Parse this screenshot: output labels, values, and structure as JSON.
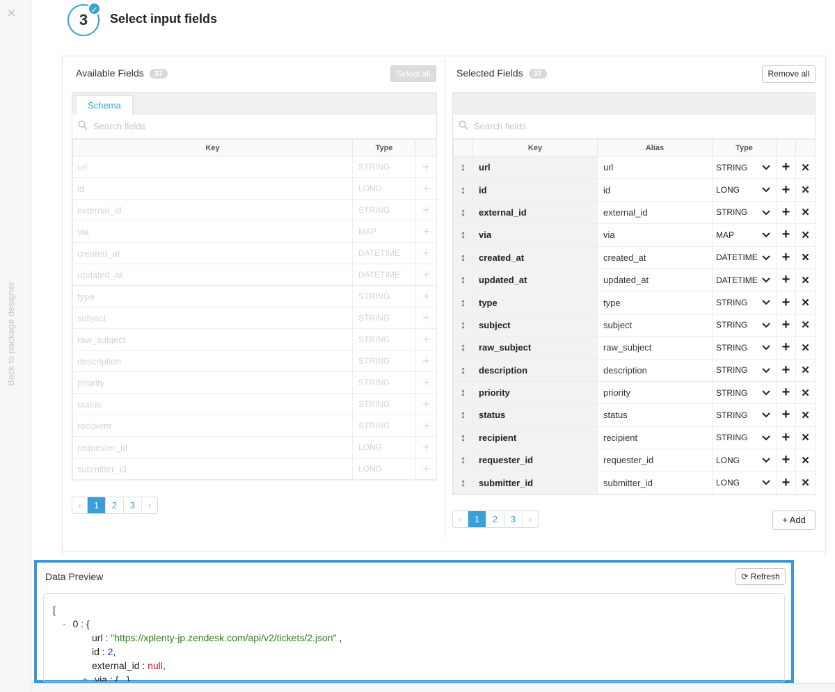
{
  "sidebar": {
    "close_icon": "×",
    "back_label": "Back to package designer"
  },
  "step": {
    "number": "3",
    "title": "Select input fields"
  },
  "available": {
    "heading": "Available Fields",
    "count": "37",
    "select_all": "Select all",
    "tab": "Schema",
    "search_placeholder": "Search fields",
    "columns": {
      "key": "Key",
      "type": "Type"
    },
    "rows": [
      {
        "key": "url",
        "type": "STRING"
      },
      {
        "key": "id",
        "type": "LONG"
      },
      {
        "key": "external_id",
        "type": "STRING"
      },
      {
        "key": "via",
        "type": "MAP"
      },
      {
        "key": "created_at",
        "type": "DATETIME"
      },
      {
        "key": "updated_at",
        "type": "DATETIME"
      },
      {
        "key": "type",
        "type": "STRING"
      },
      {
        "key": "subject",
        "type": "STRING"
      },
      {
        "key": "raw_subject",
        "type": "STRING"
      },
      {
        "key": "description",
        "type": "STRING"
      },
      {
        "key": "priority",
        "type": "STRING"
      },
      {
        "key": "status",
        "type": "STRING"
      },
      {
        "key": "recipient",
        "type": "STRING"
      },
      {
        "key": "requester_id",
        "type": "LONG"
      },
      {
        "key": "submitter_id",
        "type": "LONG"
      }
    ],
    "pager": {
      "prev": "‹",
      "pages": [
        "1",
        "2",
        "3"
      ],
      "next": "›",
      "active": "1"
    }
  },
  "selected": {
    "heading": "Selected Fields",
    "count": "37",
    "remove_all": "Remove all",
    "search_placeholder": "Search fields",
    "columns": {
      "key": "Key",
      "alias": "Alias",
      "type": "Type"
    },
    "rows": [
      {
        "key": "url",
        "alias": "url",
        "type": "STRING"
      },
      {
        "key": "id",
        "alias": "id",
        "type": "LONG"
      },
      {
        "key": "external_id",
        "alias": "external_id",
        "type": "STRING"
      },
      {
        "key": "via",
        "alias": "via",
        "type": "MAP"
      },
      {
        "key": "created_at",
        "alias": "created_at",
        "type": "DATETIME"
      },
      {
        "key": "updated_at",
        "alias": "updated_at",
        "type": "DATETIME"
      },
      {
        "key": "type",
        "alias": "type",
        "type": "STRING"
      },
      {
        "key": "subject",
        "alias": "subject",
        "type": "STRING"
      },
      {
        "key": "raw_subject",
        "alias": "raw_subject",
        "type": "STRING"
      },
      {
        "key": "description",
        "alias": "description",
        "type": "STRING"
      },
      {
        "key": "priority",
        "alias": "priority",
        "type": "STRING"
      },
      {
        "key": "status",
        "alias": "status",
        "type": "STRING"
      },
      {
        "key": "recipient",
        "alias": "recipient",
        "type": "STRING"
      },
      {
        "key": "requester_id",
        "alias": "requester_id",
        "type": "LONG"
      },
      {
        "key": "submitter_id",
        "alias": "submitter_id",
        "type": "LONG"
      }
    ],
    "pager": {
      "prev": "‹",
      "pages": [
        "1",
        "2",
        "3"
      ],
      "next": "›",
      "active": "1"
    },
    "add_label": "+ Add"
  },
  "preview": {
    "title": "Data Preview",
    "refresh_label": "Refresh",
    "code": {
      "open_bracket": "[",
      "minus": "-",
      "item_open": "0 : {",
      "url_key": "url : ",
      "url_val": "\"https://xplenty-jp.zendesk.com/api/v2/tickets/2.json\"",
      "url_tail": " ,",
      "id_key": "id : ",
      "id_val": "2",
      "id_tail": ",",
      "ext_key": "external_id : ",
      "ext_val": "null",
      "ext_tail": ",",
      "plus": "+",
      "via_line": "via : {...},"
    }
  },
  "colors": {
    "accent": "#3a9fd9",
    "highlight_border": "#3b97dd"
  }
}
